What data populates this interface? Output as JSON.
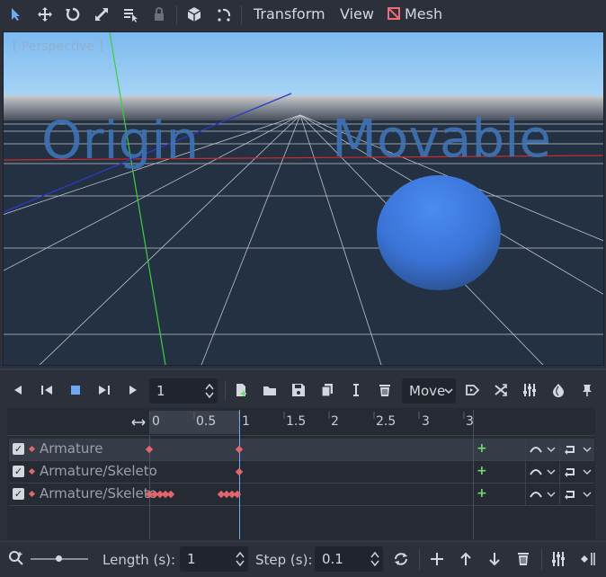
{
  "toolbar": {
    "icons": [
      "select-arrow-icon",
      "move-icon",
      "rotate-icon",
      "scale-icon",
      "list-select-icon",
      "lock-icon",
      "cube-icon",
      "snap-icon"
    ],
    "menus": {
      "transform": "Transform",
      "view": "View",
      "mesh": "Mesh"
    },
    "accent": "#6ea8f7"
  },
  "viewport": {
    "label": "[ Perspective ]",
    "text_origin": "Origin",
    "text_movable": "Movable",
    "sky_color": "#87c3f0",
    "ground_color": "#243142",
    "sphere_color": "#3c7be6"
  },
  "animation": {
    "frame_value": "1",
    "mode_select": "Move",
    "ruler": [
      "0",
      "0.5",
      "1",
      "1.5",
      "2",
      "2.5",
      "3",
      "3"
    ],
    "tracks": [
      {
        "name": "Armature",
        "checked": true
      },
      {
        "name": "Armature/Skeleto",
        "checked": true
      },
      {
        "name": "Armature/Skeleto",
        "checked": true
      }
    ],
    "length_label": "Length (s):",
    "length_value": "1",
    "step_label": "Step (s):",
    "step_value": "0.1"
  }
}
